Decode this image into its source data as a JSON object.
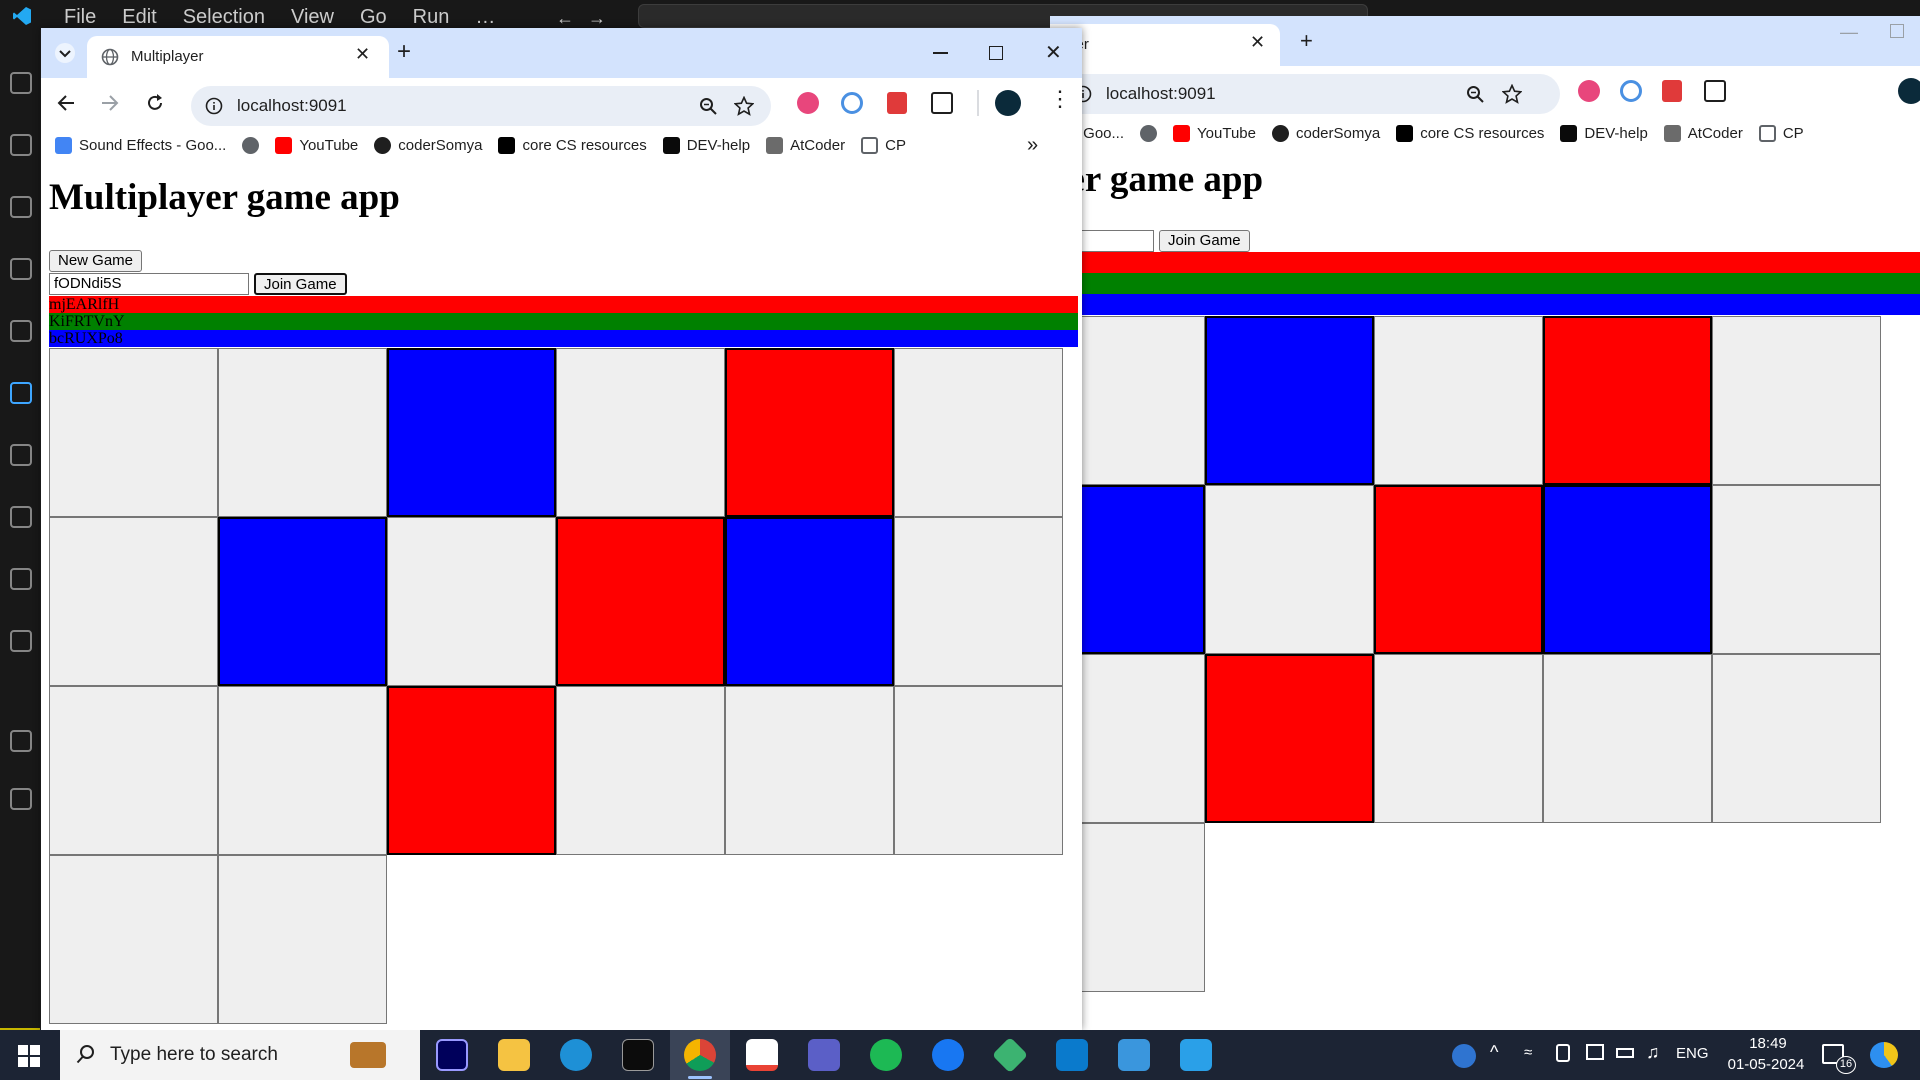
{
  "vscode": {
    "menu": [
      "File",
      "Edit",
      "Selection",
      "View",
      "Go",
      "Run",
      "…"
    ]
  },
  "window_front": {
    "tab_title": "Multiplayer",
    "url": "localhost:9091",
    "bookmarks": [
      {
        "label": "Sound Effects - Goo...",
        "icon": "google-icon",
        "color": "#4285f4"
      },
      {
        "label": "",
        "icon": "globe-icon",
        "color": "#5f6368"
      },
      {
        "label": "YouTube",
        "icon": "youtube-icon",
        "color": "#ff0000"
      },
      {
        "label": "coderSomya",
        "icon": "github-icon",
        "color": "#1f1f1f"
      },
      {
        "label": "core CS resources",
        "icon": "medium-icon",
        "color": "#000000"
      },
      {
        "label": "DEV-help",
        "icon": "dev-icon",
        "color": "#0a0a0a"
      },
      {
        "label": "AtCoder",
        "icon": "atcoder-icon",
        "color": "#6b6b6b"
      },
      {
        "label": "CP",
        "icon": "folder-icon",
        "color": "#5f6368"
      }
    ],
    "more_bookmarks": "»"
  },
  "window_back": {
    "tab_title": "yer",
    "url": "localhost:9091",
    "bookmarks": [
      {
        "label": "- Goo...",
        "icon": "google-icon",
        "color": "#4285f4"
      },
      {
        "label": "",
        "icon": "globe-icon",
        "color": "#5f6368"
      },
      {
        "label": "YouTube",
        "icon": "youtube-icon",
        "color": "#ff0000"
      },
      {
        "label": "coderSomya",
        "icon": "github-icon",
        "color": "#1f1f1f"
      },
      {
        "label": "core CS resources",
        "icon": "medium-icon",
        "color": "#000000"
      },
      {
        "label": "DEV-help",
        "icon": "dev-icon",
        "color": "#0a0a0a"
      },
      {
        "label": "AtCoder",
        "icon": "atcoder-icon",
        "color": "#6b6b6b"
      },
      {
        "label": "CP",
        "icon": "folder-icon",
        "color": "#5f6368"
      }
    ],
    "heading": "yer game app",
    "join_label": "Join Game"
  },
  "app": {
    "heading": "Multiplayer game app",
    "new_game_label": "New Game",
    "game_id_value": "fODNdi5S",
    "join_label": "Join Game",
    "players": [
      {
        "id": "mjEARlfH",
        "color": "#ff0000"
      },
      {
        "id": "KiFRTVnY",
        "color": "#008000"
      },
      {
        "id": "bcRUXPo8",
        "color": "#0000ff"
      }
    ],
    "board_front": [
      [
        "empty",
        "empty",
        "blue",
        "empty",
        "red",
        "empty"
      ],
      [
        "empty",
        "blue",
        "empty",
        "red",
        "blue",
        "empty"
      ],
      [
        "empty",
        "empty",
        "red",
        "empty",
        "empty",
        "empty"
      ],
      [
        "empty",
        "empty"
      ]
    ],
    "board_back": [
      [
        "empty",
        "empty",
        "blue",
        "empty",
        "red",
        "empty"
      ],
      [
        "empty",
        "blue",
        "empty",
        "red",
        "blue",
        "empty"
      ],
      [
        "empty",
        "empty",
        "red",
        "empty",
        "empty",
        "empty"
      ],
      [
        "empty",
        "empty"
      ]
    ]
  },
  "taskbar": {
    "search_placeholder": "Type here to search",
    "language": "ENG",
    "time": "18:49",
    "date": "01-05-2024",
    "notification_count": "16"
  }
}
